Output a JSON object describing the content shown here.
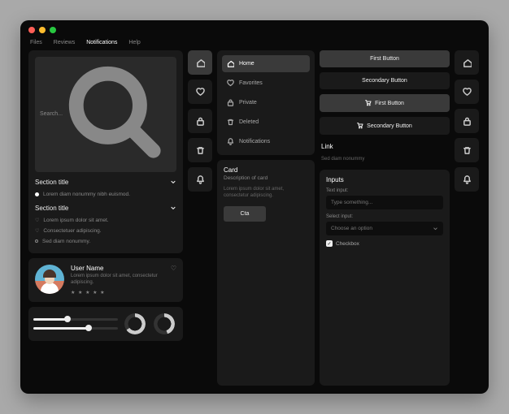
{
  "menubar": {
    "items": [
      "Files",
      "Reviews",
      "Notifications",
      "Help"
    ],
    "active": 2
  },
  "search_placeholder": "Search...",
  "sidebar": {
    "sections": [
      {
        "title": "Section title",
        "items": [
          {
            "text": "Lorem diam nonummy nibh euismod."
          }
        ]
      },
      {
        "title": "Section title",
        "items": [
          {
            "text": "Lorem ipsum dolor sit amet."
          },
          {
            "text": "Consectetuer adipiscing."
          },
          {
            "text": "Sed diam nonummy."
          }
        ]
      }
    ]
  },
  "nav": [
    {
      "icon": "home",
      "label": "Home"
    },
    {
      "icon": "heart",
      "label": "Favorites"
    },
    {
      "icon": "lock",
      "label": "Private"
    },
    {
      "icon": "trash",
      "label": "Deleted"
    },
    {
      "icon": "bell",
      "label": "Notifications"
    }
  ],
  "buttons": {
    "first": "First Button",
    "secondary": "Secondary Button",
    "cart_first": "First Button",
    "cart_secondary": "Secondary Button",
    "link": "Link",
    "link_sub": "Sed diam nonummy"
  },
  "user": {
    "name": "User Name",
    "desc": "Lorem ipsum dolor sit amet, consectetur adipiscing.",
    "stars": "★ ★ ★ ★ ★"
  },
  "sliders": [
    40,
    65
  ],
  "donuts": [
    65,
    45
  ],
  "card": {
    "title": "Card",
    "subtitle": "Description of card",
    "body": "Lorem ipsum dolor sit amet, consectetur adipiscing.",
    "cta": "Cta"
  },
  "inputs": {
    "title": "Inputs",
    "text_label": "Text input:",
    "text_placeholder": "Type something...",
    "select_label": "Select input:",
    "select_placeholder": "Choose an option",
    "checkbox": "Checkbox"
  }
}
